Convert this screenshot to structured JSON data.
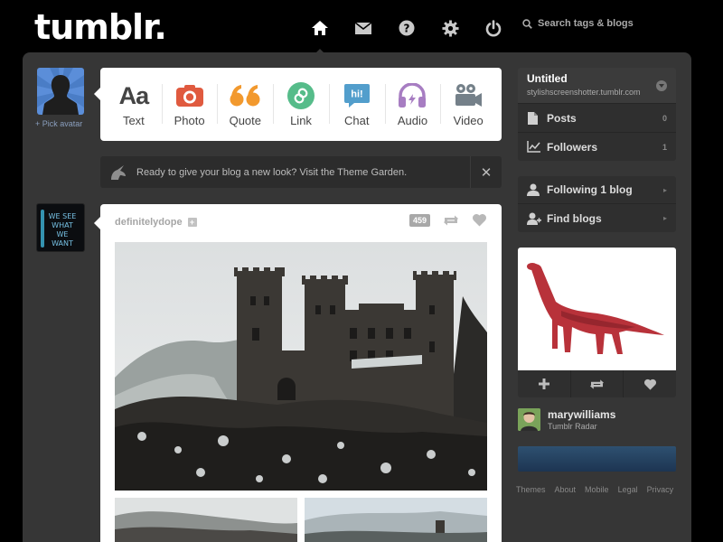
{
  "brand": {
    "logo_text": "tumblr."
  },
  "topnav": {
    "items": [
      {
        "name": "dashboard",
        "icon": "home-icon"
      },
      {
        "name": "messages",
        "icon": "envelope-icon"
      },
      {
        "name": "help",
        "icon": "question-icon"
      },
      {
        "name": "settings",
        "icon": "gear-icon"
      },
      {
        "name": "logout",
        "icon": "power-icon"
      }
    ],
    "search_placeholder": "Search tags & blogs"
  },
  "avatar": {
    "pick_label": "+ Pick avatar"
  },
  "post_types": [
    {
      "label": "Text",
      "icon": "text-icon"
    },
    {
      "label": "Photo",
      "icon": "camera-icon",
      "color": "#e05a3f"
    },
    {
      "label": "Quote",
      "icon": "quote-icon",
      "color": "#f2992e"
    },
    {
      "label": "Link",
      "icon": "link-icon",
      "color": "#56bc8a"
    },
    {
      "label": "Chat",
      "icon": "chat-icon",
      "color": "#529ecc",
      "glyph": "hi!"
    },
    {
      "label": "Audio",
      "icon": "headphones-icon",
      "color": "#a77dc2"
    },
    {
      "label": "Video",
      "icon": "video-camera-icon",
      "color": "#748089"
    }
  ],
  "notice": {
    "text": "Ready to give your blog a new look? Visit the Theme Garden.",
    "close": "✕"
  },
  "post": {
    "author": "definitelydope",
    "notes": "459",
    "avatar_text": "WE SEE WHAT WE WANT"
  },
  "sidebar": {
    "blog_title": "Untitled",
    "blog_url": "stylishscreenshotter.tumblr.com",
    "posts_label": "Posts",
    "posts_count": "0",
    "followers_label": "Followers",
    "followers_count": "1",
    "following_label": "Following 1 blog",
    "find_label": "Find blogs",
    "arrow": "▸"
  },
  "radar": {
    "user": "marywilliams",
    "subtitle": "Tumblr Radar"
  },
  "footer": {
    "links": [
      "Themes",
      "About",
      "Mobile",
      "Legal",
      "Privacy"
    ]
  },
  "colors": {
    "background": "#000000",
    "panel": "#363636",
    "avatar_blue": "#5b8ed9"
  }
}
